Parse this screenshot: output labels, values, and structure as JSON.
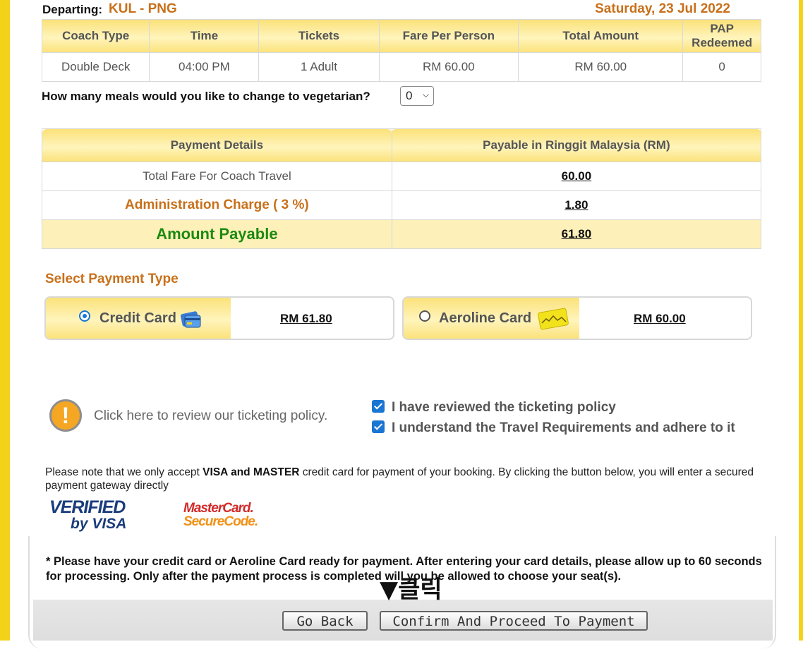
{
  "departure": {
    "label": "Departing:",
    "route": "KUL - PNG",
    "date": "Saturday, 23 Jul 2022"
  },
  "trip_table": {
    "headers": [
      "Coach Type",
      "Time",
      "Tickets",
      "Fare Per Person",
      "Total Amount",
      "PAP Redeemed"
    ],
    "header_pap_line1": "PAP",
    "header_pap_line2": "Redeemed",
    "row": [
      "Double Deck",
      "04:00 PM",
      "1 Adult",
      "RM 60.00",
      "RM 60.00",
      "0"
    ]
  },
  "vegetarian": {
    "question": "How many meals would you like to change to vegetarian?",
    "selected": "0"
  },
  "payment_details": {
    "headers": [
      "Payment Details",
      "Payable in Ringgit Malaysia (RM)"
    ],
    "rows": [
      {
        "label": "Total Fare For Coach Travel",
        "amount": "60.00"
      },
      {
        "label": "Administration Charge ( 3 %)",
        "amount": "1.80"
      },
      {
        "label": "Amount Payable",
        "amount": "61.80"
      }
    ]
  },
  "payment_type": {
    "title": "Select Payment Type",
    "options": [
      {
        "name": "Credit Card",
        "amount": "RM 61.80",
        "selected": true,
        "icon": "credit-card-icon"
      },
      {
        "name": "Aeroline Card",
        "amount": "RM 60.00",
        "selected": false,
        "icon": "aeroline-card-icon"
      }
    ]
  },
  "policy": {
    "link_text": "Click here to review our ticketing policy.",
    "icon": "warning-icon",
    "checkboxes": [
      {
        "label": "I have reviewed the ticketing policy",
        "checked": true
      },
      {
        "label": "I understand the Travel Requirements and adhere to it",
        "checked": true
      }
    ]
  },
  "note": {
    "prefix": "Please note that we only accept ",
    "bold": "VISA and MASTER",
    "suffix": " credit card for payment of your booking. By clicking the button below, you will enter a secured payment gateway directly"
  },
  "logos": {
    "visa_line1": "VERIFIED",
    "visa_line2": "by VISA",
    "mc_line1": "MasterCard.",
    "mc_line2": "SecureCode."
  },
  "reminder": "* Please have your credit card or Aeroline Card ready for payment. After entering your card details, please allow up to 60 seconds for processing. Only after the payment process is completed will you be allowed to choose your seat(s).",
  "buttons": {
    "back": "Go Back",
    "confirm": "Confirm And Proceed To Payment"
  },
  "annotation": "▼클릭",
  "colors": {
    "accent_yellow": "#f5d21a",
    "orange_text": "#c8701a",
    "green_text": "#1d8a12",
    "radio_blue": "#1976d2"
  }
}
